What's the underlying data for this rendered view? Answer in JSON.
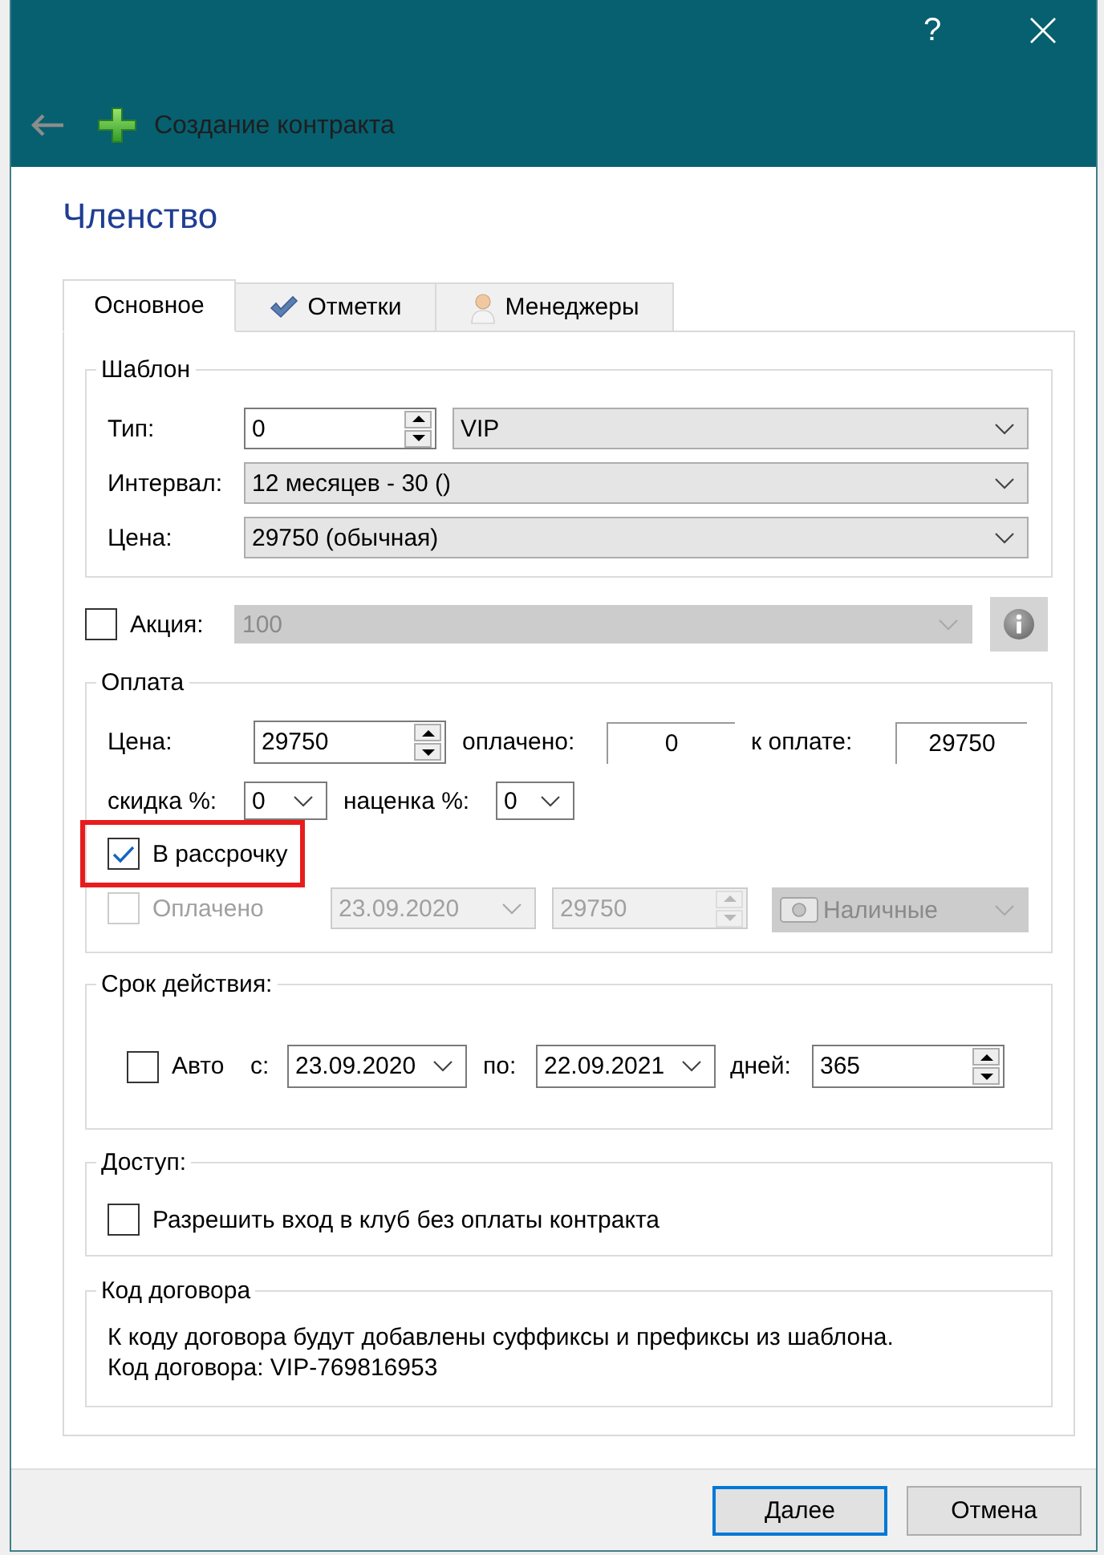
{
  "window": {
    "help": "?"
  },
  "toolbar": {
    "title": "Создание контракта"
  },
  "page_title": "Членство",
  "tabs": [
    {
      "label": "Основное",
      "selected": true
    },
    {
      "label": "Отметки",
      "selected": false
    },
    {
      "label": "Менеджеры",
      "selected": false
    }
  ],
  "template": {
    "legend": "Шаблон",
    "type": {
      "label": "Тип:",
      "number": "0",
      "value": "VIP"
    },
    "interval": {
      "label": "Интервал:",
      "value": "12 месяцев - 30 ()"
    },
    "price": {
      "label": "Цена:",
      "value": "29750 (обычная)"
    }
  },
  "promo": {
    "label": "Акция:",
    "checked": false,
    "value": "100",
    "disabled": true
  },
  "payment": {
    "legend": "Оплата",
    "price": {
      "label": "Цена:",
      "value": "29750"
    },
    "paid": {
      "label": "оплачено:",
      "value": "0"
    },
    "due": {
      "label": "к оплате:",
      "value": "29750"
    },
    "discount": {
      "label": "скидка %:",
      "value": "0"
    },
    "markup": {
      "label": "наценка %:",
      "value": "0"
    },
    "installments": {
      "label": "В рассрочку",
      "checked": true,
      "highlighted": true
    },
    "paid_row": {
      "label": "Оплачено",
      "checked": false,
      "disabled": true,
      "date": "23.09.2020",
      "amount": "29750",
      "method": "Наличные"
    }
  },
  "validity": {
    "legend": "Срок действия:",
    "auto": {
      "label": "Авто",
      "checked": false
    },
    "from": {
      "label": "с:",
      "value": "23.09.2020"
    },
    "to": {
      "label": "по:",
      "value": "22.09.2021"
    },
    "days": {
      "label": "дней:",
      "value": "365"
    }
  },
  "access": {
    "legend": "Доступ:",
    "allow": {
      "label": "Разрешить вход в клуб без оплаты контракта",
      "checked": false
    }
  },
  "contract_code": {
    "legend": "Код договора",
    "lines": [
      "К коду договора будут добавлены суффиксы и префиксы из шаблона.",
      "Код договора: VIP-769816953"
    ]
  },
  "buttons": [
    {
      "label": "Далее",
      "focused": true
    },
    {
      "label": "Отмена",
      "focused": false
    }
  ]
}
